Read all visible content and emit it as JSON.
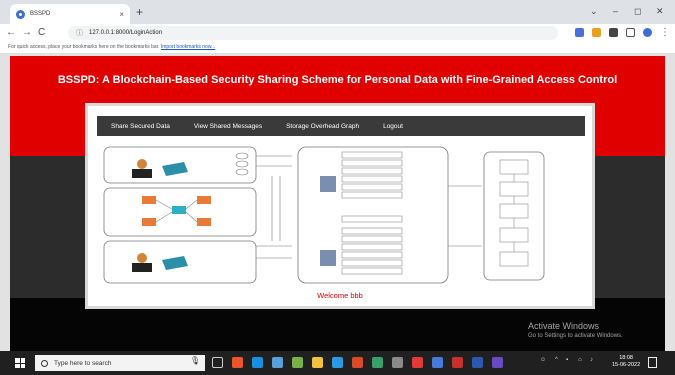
{
  "browser": {
    "tab_title": "BSSPD",
    "tab_close": "×",
    "new_tab": "+",
    "window_controls": [
      "⌄",
      "–",
      "◻",
      "✕"
    ],
    "nav": {
      "back": "←",
      "forward": "→",
      "reload": "C"
    },
    "address_url": "127.0.0.1:8000/LoginAction",
    "bookmarks_text": "For quick access, place your bookmarks here on the bookmarks bar.",
    "bookmarks_link": "Import bookmarks now..."
  },
  "page": {
    "headline": "BSSPD: A Blockchain-Based Security Sharing Scheme for Personal Data with Fine-Grained Access Control",
    "menu": [
      "Share Secured Data",
      "View Shared Messages",
      "Storage Overhead Graph",
      "Logout"
    ],
    "welcome": "Welcome bbb"
  },
  "watermark": {
    "line1": "Activate Windows",
    "line2": "Go to Settings to activate Windows."
  },
  "taskbar": {
    "search_placeholder": "Type here to search",
    "time": "18:08",
    "date": "15-06-2022"
  },
  "colors": {
    "red_band": "#e00000",
    "menu_bg": "#3a3a3a",
    "welcome_text": "#e00000"
  }
}
